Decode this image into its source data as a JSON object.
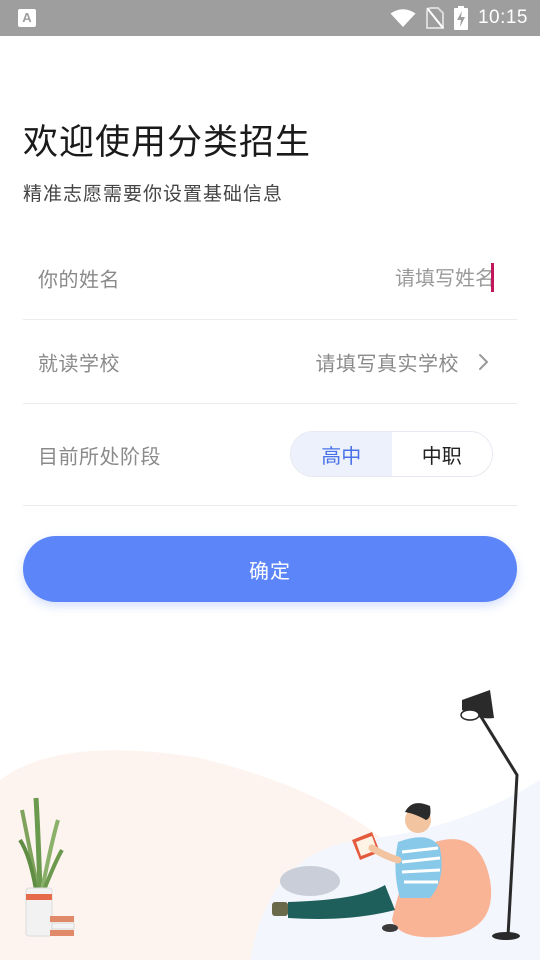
{
  "status_bar": {
    "app_icon_letter": "A",
    "time": "10:15",
    "icons": [
      "wifi-icon",
      "no-sim-icon",
      "battery-charging-icon"
    ]
  },
  "header": {
    "title": "欢迎使用分类招生",
    "subtitle": "精准志愿需要你设置基础信息"
  },
  "form": {
    "name": {
      "label": "你的姓名",
      "placeholder": "请填写姓名",
      "value": ""
    },
    "school": {
      "label": "就读学校",
      "value": "请填写真实学校"
    },
    "stage": {
      "label": "目前所处阶段",
      "options": [
        {
          "label": "高中",
          "selected": true
        },
        {
          "label": "中职",
          "selected": false
        }
      ]
    },
    "confirm_label": "确定"
  },
  "colors": {
    "accent": "#5b85f8",
    "selected_text": "#4a72e8",
    "selected_bg": "#edf1fc",
    "cursor": "#c2185b",
    "status_bar": "#9e9e9e"
  }
}
